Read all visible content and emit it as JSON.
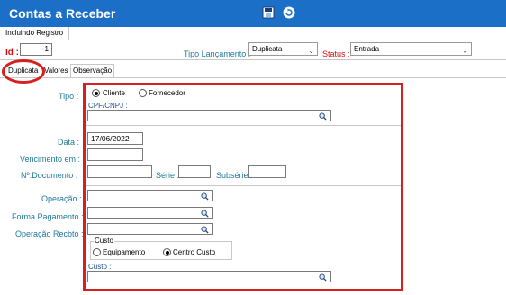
{
  "window": {
    "title": "Contas a Receber"
  },
  "toolbar": {
    "save_icon": "floppy-disk-icon",
    "refresh_icon": "refresh-icon"
  },
  "subtab": {
    "label": "Incluindo Registro"
  },
  "header": {
    "id_label": "Id :",
    "id_value": "-1",
    "tipo_lancamento_label": "Tipo Lançamento :",
    "tipo_lancamento_value": "Duplicata",
    "status_label": "Status :",
    "status_value": "Entrada"
  },
  "tabs": [
    {
      "label": "Duplicata",
      "active": true
    },
    {
      "label": "Valores"
    },
    {
      "label": "Observação"
    }
  ],
  "form": {
    "tipo_label": "Tipo :",
    "radio_cliente": "Cliente",
    "radio_fornecedor": "Fornecedor",
    "cpf_label": "CPF/CNPJ :",
    "data_label": "Data :",
    "data_value": "17/06/2022",
    "vencimento_label": "Vencimento em :",
    "documento_label": "Nº.Documento :",
    "serie_label": "Série :",
    "subserie_label": "Subsérie :",
    "operacao_label": "Operação :",
    "forma_pagamento_label": "Forma Pagamento :",
    "operacao_recbto_label": "Operação Recbto :",
    "custo_group_label": "Custo",
    "radio_equipamento": "Equipamento",
    "radio_centro_custo": "Centro Custo",
    "custo_label": "Custo :"
  },
  "colors": {
    "titlebar": "#1b6fc7",
    "highlight": "#d62020",
    "label_blue": "#1f7a9a",
    "label_red": "#d01010"
  }
}
